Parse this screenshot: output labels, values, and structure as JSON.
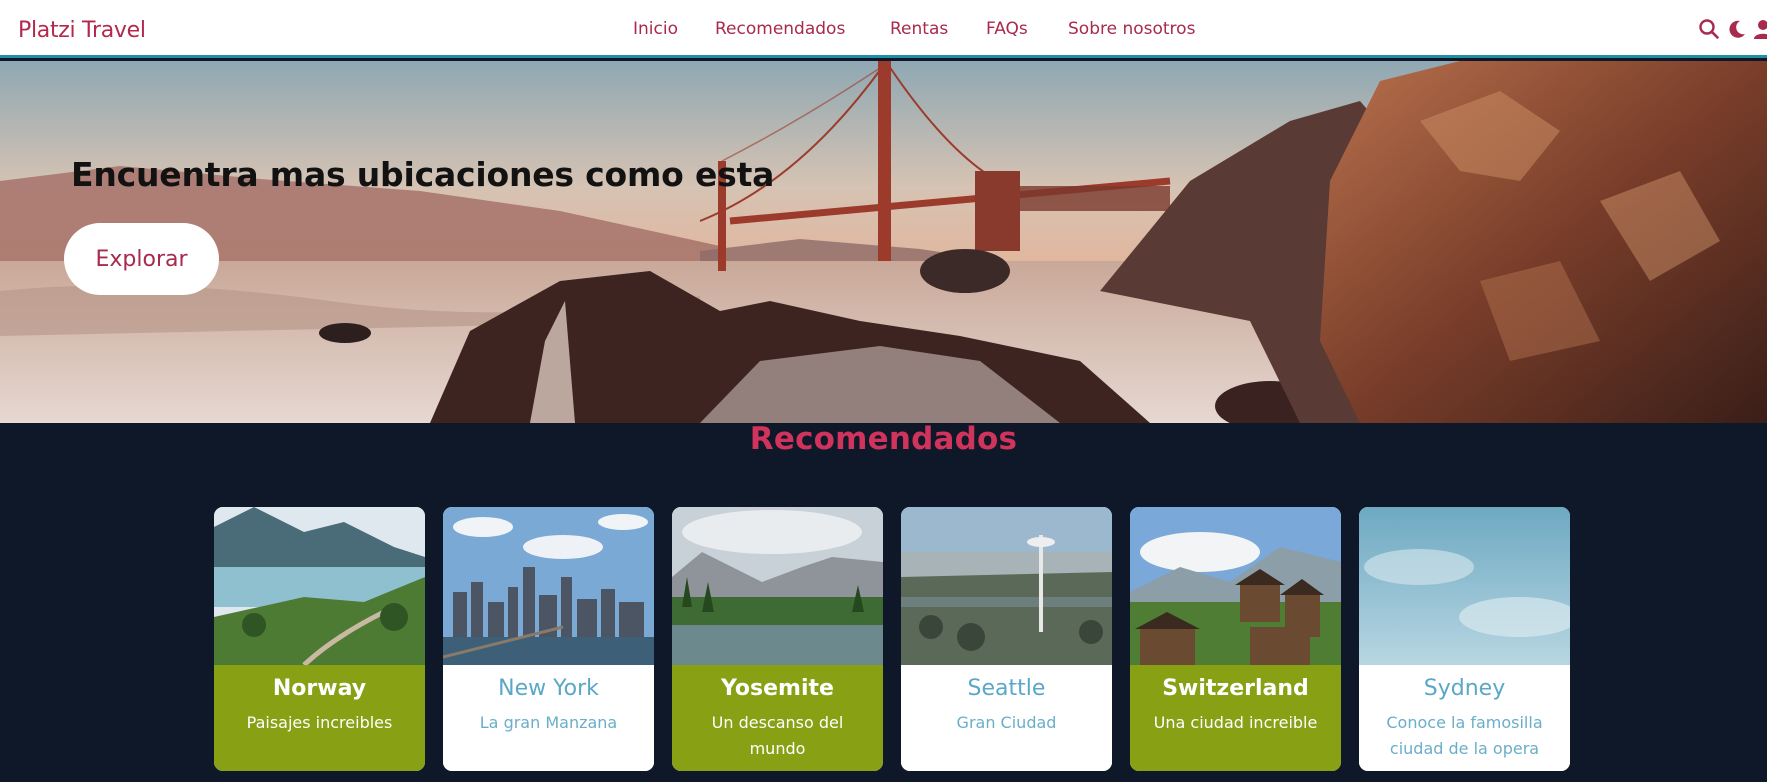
{
  "header": {
    "logo": "Platzi Travel",
    "nav": [
      "Inicio",
      "Recomendados",
      "Rentas",
      "FAQs",
      "Sobre nosotros"
    ],
    "icons": [
      "search-icon",
      "moon-icon",
      "user-icon"
    ]
  },
  "hero": {
    "title": "Encuentra mas ubicaciones como esta",
    "button": "Explorar"
  },
  "recommended": {
    "title": "Recomendados",
    "cards": [
      {
        "title": "Norway",
        "description": "Paisajes increibles",
        "style": "green"
      },
      {
        "title": "New York",
        "description": "La gran Manzana",
        "style": "white"
      },
      {
        "title": "Yosemite",
        "description": "Un descanso del mundo",
        "style": "green"
      },
      {
        "title": "Seattle",
        "description": "Gran Ciudad",
        "style": "white"
      },
      {
        "title": "Switzerland",
        "description": "Una ciudad increible",
        "style": "green"
      },
      {
        "title": "Sydney",
        "description": "Conoce la famosilla ciudad de la opera",
        "style": "white"
      }
    ]
  },
  "colors": {
    "brand": "#a82a4d",
    "accent_line": "#1f8fa3",
    "section_bg": "#0f1828",
    "card_green": "#87a014",
    "card_white_text": "#5aa7c8"
  }
}
